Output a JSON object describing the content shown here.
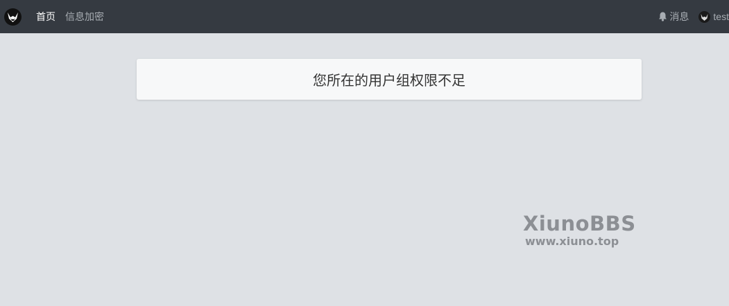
{
  "navbar": {
    "logo_icon": "fox-logo-icon",
    "links": [
      {
        "label": "首页",
        "active": true
      },
      {
        "label": "信息加密",
        "active": false
      }
    ],
    "messages_label": "消息",
    "messages_icon": "bell-icon",
    "user_label": "test",
    "user_icon": "avatar-icon"
  },
  "main": {
    "message": "您所在的用户组权限不足"
  },
  "watermark": {
    "title": "XiunoBBS",
    "url": "www.xiuno.top"
  },
  "colors": {
    "navbar_bg": "#353a41",
    "page_bg": "#dee1e5",
    "card_bg": "#f7f8f9"
  }
}
